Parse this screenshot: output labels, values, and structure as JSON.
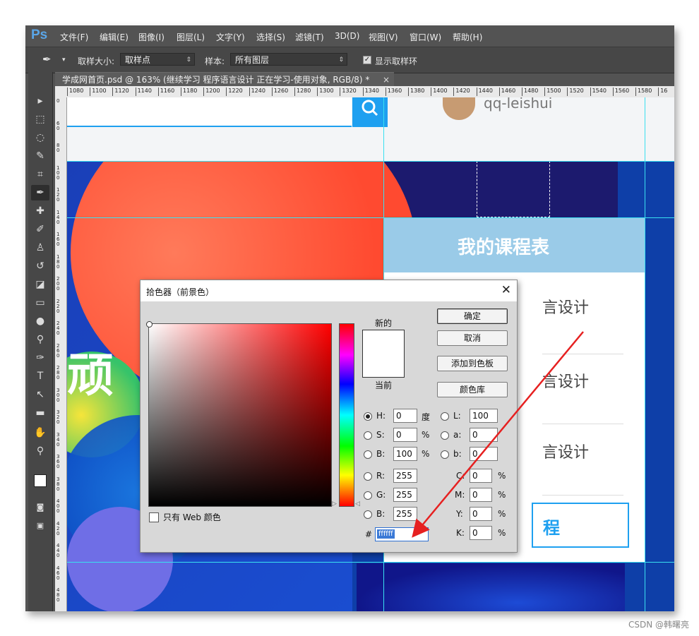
{
  "app": {
    "logo": "Ps",
    "menu": [
      "文件(F)",
      "编辑(E)",
      "图像(I)",
      "图层(L)",
      "文字(Y)",
      "选择(S)",
      "滤镜(T)",
      "3D(D)",
      "视图(V)",
      "窗口(W)",
      "帮助(H)"
    ]
  },
  "options_bar": {
    "sample_size_label": "取样大小:",
    "sample_size_value": "取样点",
    "sample_label": "样本:",
    "sample_value": "所有图层",
    "show_ring_label": "显示取样环",
    "show_ring_checked": true
  },
  "document": {
    "tab_title": "学成网首页.psd @ 163% (继续学习 程序语言设计 正在学习-使用对象, RGB/8) *",
    "tab_close": "×",
    "ruler_top": [
      "1080",
      "1100",
      "1120",
      "1140",
      "1160",
      "1180",
      "1200",
      "1220",
      "1240",
      "1260",
      "1280",
      "1300",
      "1320",
      "1340",
      "1360",
      "1380",
      "1400",
      "1420",
      "1440",
      "1460",
      "1480",
      "1500",
      "1520",
      "1540",
      "1560",
      "1580",
      "16"
    ],
    "ruler_left": [
      "0",
      "6 0",
      "8 0",
      "1 0 0",
      "1 2 0",
      "1 4 0",
      "1 6 0",
      "1 8 0",
      "2 0 0",
      "2 2 0",
      "2 4 0",
      "2 6 0",
      "2 8 0",
      "3 0 0",
      "3 2 0",
      "3 4 0",
      "3 6 0",
      "3 8 0",
      "4 0 0",
      "4 2 0",
      "4 4 0",
      "4 6 0",
      "4 8 0"
    ]
  },
  "canvas": {
    "user_name": "qq-leishui",
    "banner_char": "顽",
    "schedule_title": "我的课程表",
    "course_rows": [
      "言设计",
      "言设计",
      "言设计"
    ],
    "bottom_button_text": "程"
  },
  "dialog": {
    "title": "拾色器（前景色）",
    "close": "✕",
    "new_label": "新的",
    "current_label": "当前",
    "ok": "确定",
    "cancel": "取消",
    "add_swatch": "添加到色板",
    "color_lib": "颜色库",
    "web_only_label": "只有 Web 颜色",
    "hsb": [
      {
        "label": "H:",
        "value": "0",
        "unit": "度",
        "selected": true
      },
      {
        "label": "S:",
        "value": "0",
        "unit": "%",
        "selected": false
      },
      {
        "label": "B:",
        "value": "100",
        "unit": "%",
        "selected": false
      }
    ],
    "rgb": [
      {
        "label": "R:",
        "value": "255"
      },
      {
        "label": "G:",
        "value": "255"
      },
      {
        "label": "B:",
        "value": "255"
      }
    ],
    "lab": [
      {
        "label": "L:",
        "value": "100"
      },
      {
        "label": "a:",
        "value": "0"
      },
      {
        "label": "b:",
        "value": "0"
      }
    ],
    "cmyk": [
      {
        "label": "C:",
        "value": "0",
        "unit": "%"
      },
      {
        "label": "M:",
        "value": "0",
        "unit": "%"
      },
      {
        "label": "Y:",
        "value": "0",
        "unit": "%"
      },
      {
        "label": "K:",
        "value": "0",
        "unit": "%"
      }
    ],
    "hex_prefix": "#",
    "hex_value": "ffffff",
    "new_color": "#ffffff",
    "current_color": "#ffffff"
  },
  "watermark": "CSDN @韩曙亮",
  "colors": {
    "accent_blue": "#1ea0f0",
    "banner_blue": "#0e3fa8",
    "schedule_header": "#9acbe8",
    "arrow_red": "#e62020"
  }
}
